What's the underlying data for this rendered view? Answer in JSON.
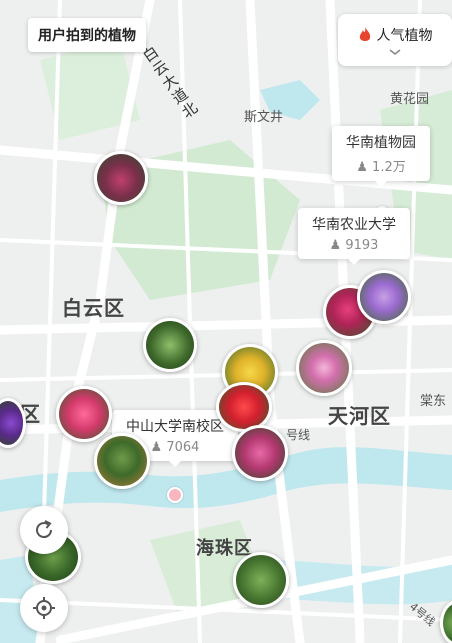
{
  "header": {
    "user_photos_label": "用户拍到的植物",
    "hot_plants_label": "人气植物"
  },
  "map": {
    "districts": [
      "白云区",
      "天河区",
      "海珠区",
      "区"
    ],
    "places": [
      "斯文井",
      "黄花园",
      "棠东"
    ],
    "road_name": "白云大道北",
    "metro_label": "号线",
    "metro_label_2": "4号线"
  },
  "callouts": [
    {
      "name": "华南植物园",
      "count": "1.2万"
    },
    {
      "name": "华南农业大学",
      "count": "9193"
    },
    {
      "name": "中山大学南校区",
      "count": "7064"
    }
  ],
  "colors": {
    "water": "#bfe7ee",
    "park": "#cfe9d1",
    "road": "#ffffff",
    "hot_icon": "#e8452f",
    "dot": "#f7b6c0"
  },
  "icons": {
    "hot": "flame-icon",
    "chevron": "chevron-down-icon",
    "refresh": "refresh-icon",
    "locate": "locate-icon",
    "count": "person-icon"
  }
}
